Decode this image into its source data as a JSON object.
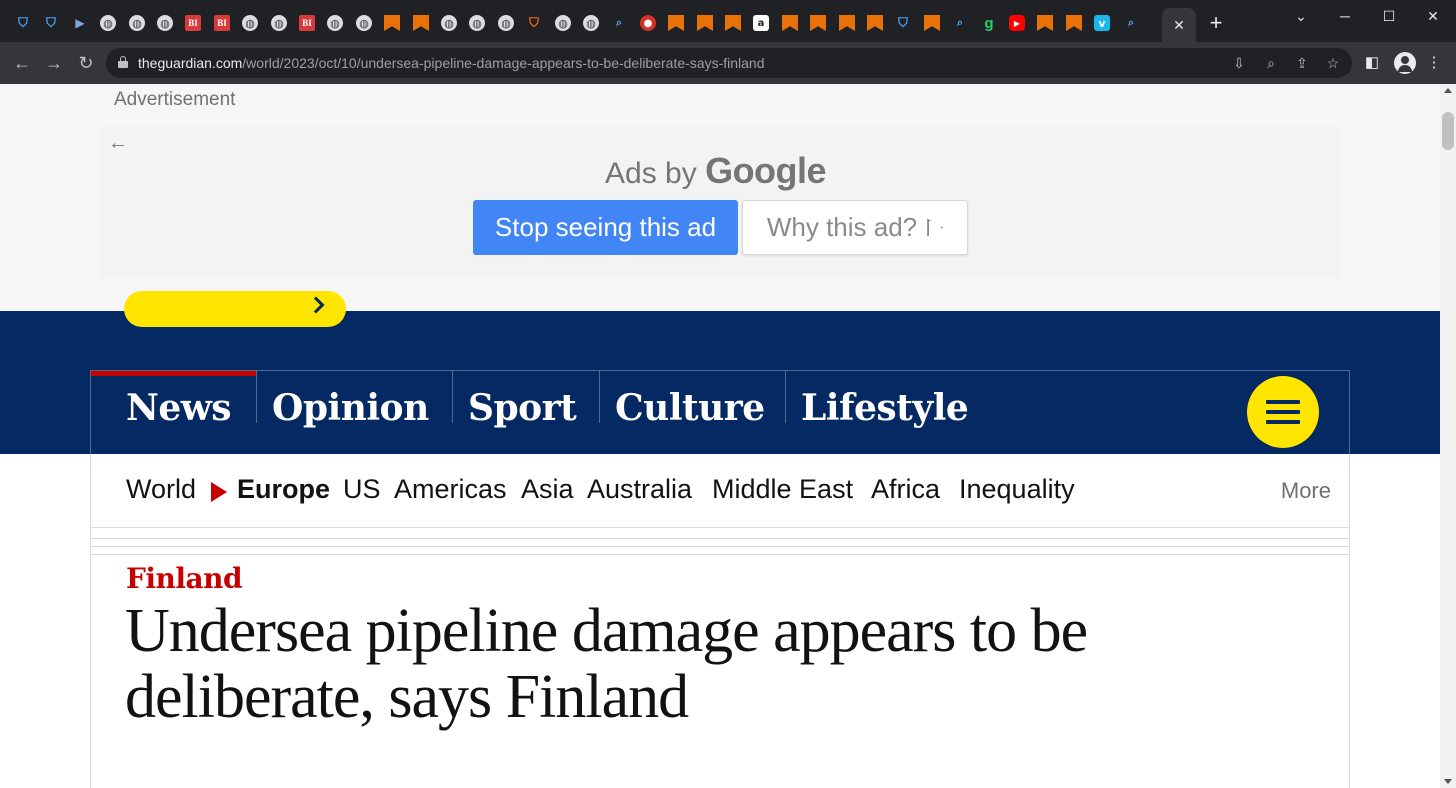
{
  "browser": {
    "tabs": [
      {
        "icon": "shield-icon",
        "glyph": "⛉",
        "kind": "shield"
      },
      {
        "icon": "shield-icon",
        "glyph": "⛉",
        "kind": "shield"
      },
      {
        "icon": "arrow-icon",
        "glyph": "▶",
        "kind": "arrow"
      },
      {
        "icon": "globe-icon",
        "glyph": "◍",
        "kind": "globe"
      },
      {
        "icon": "globe-icon",
        "glyph": "◍",
        "kind": "globe"
      },
      {
        "icon": "globe-icon",
        "glyph": "◍",
        "kind": "globe"
      },
      {
        "icon": "business-insider-icon",
        "glyph": "BI",
        "kind": "bi"
      },
      {
        "icon": "business-insider-icon",
        "glyph": "BI",
        "kind": "bi"
      },
      {
        "icon": "globe-icon",
        "glyph": "◍",
        "kind": "globe"
      },
      {
        "icon": "globe-icon",
        "glyph": "◍",
        "kind": "globe"
      },
      {
        "icon": "business-insider-icon",
        "glyph": "BI",
        "kind": "bi"
      },
      {
        "icon": "globe-icon",
        "glyph": "◍",
        "kind": "globe"
      },
      {
        "icon": "globe-icon",
        "glyph": "◍",
        "kind": "globe"
      },
      {
        "icon": "bookmark-icon",
        "glyph": "",
        "kind": "bookmark"
      },
      {
        "icon": "bookmark-icon",
        "glyph": "",
        "kind": "bookmark"
      },
      {
        "icon": "globe-icon",
        "glyph": "◍",
        "kind": "globe"
      },
      {
        "icon": "globe-icon",
        "glyph": "◍",
        "kind": "globe"
      },
      {
        "icon": "globe-icon",
        "glyph": "◍",
        "kind": "globe"
      },
      {
        "icon": "brave-icon",
        "glyph": "⛉",
        "kind": "brave"
      },
      {
        "icon": "globe-icon",
        "glyph": "◍",
        "kind": "globe"
      },
      {
        "icon": "globe-icon",
        "glyph": "◍",
        "kind": "globe"
      },
      {
        "icon": "search-icon",
        "glyph": "⌕",
        "kind": "search"
      },
      {
        "icon": "pin-icon",
        "glyph": "●",
        "kind": "pin"
      },
      {
        "icon": "bookmark-icon",
        "glyph": "",
        "kind": "bookmark"
      },
      {
        "icon": "bookmark-icon",
        "glyph": "",
        "kind": "bookmark"
      },
      {
        "icon": "bookmark-icon",
        "glyph": "",
        "kind": "bookmark"
      },
      {
        "icon": "document-icon",
        "glyph": "a",
        "kind": "white"
      },
      {
        "icon": "bookmark-icon",
        "glyph": "",
        "kind": "bookmark"
      },
      {
        "icon": "bookmark-icon",
        "glyph": "",
        "kind": "bookmark"
      },
      {
        "icon": "bookmark-icon",
        "glyph": "",
        "kind": "bookmark"
      },
      {
        "icon": "bookmark-icon",
        "glyph": "",
        "kind": "bookmark"
      },
      {
        "icon": "shield-icon",
        "glyph": "⛉",
        "kind": "shield"
      },
      {
        "icon": "bookmark-icon",
        "glyph": "",
        "kind": "bookmark"
      },
      {
        "icon": "search-icon",
        "glyph": "⌕",
        "kind": "search"
      },
      {
        "icon": "grammarly-icon",
        "glyph": "g",
        "kind": "g"
      },
      {
        "icon": "youtube-icon",
        "glyph": "▶",
        "kind": "youtube"
      },
      {
        "icon": "bookmark-icon",
        "glyph": "",
        "kind": "bookmark"
      },
      {
        "icon": "bookmark-icon",
        "glyph": "",
        "kind": "bookmark"
      },
      {
        "icon": "vimeo-icon",
        "glyph": "v",
        "kind": "v"
      },
      {
        "icon": "search-icon",
        "glyph": "⌕",
        "kind": "search"
      }
    ],
    "active_tab_close": "✕",
    "new_tab": "+",
    "window": {
      "minimize": "─",
      "maximize": "☐",
      "close": "✕",
      "dropdown": "⌄"
    },
    "nav": {
      "back": "←",
      "forward": "→",
      "reload": "↻"
    },
    "address": {
      "host": "theguardian.com",
      "path": "/world/2023/oct/10/undersea-pipeline-damage-appears-to-be-deliberate-says-finland"
    },
    "omni_icons": {
      "install": "⇩",
      "zoom": "⌕",
      "share": "⇪",
      "bookmark": "☆"
    },
    "toolbar_icons": {
      "sidepanel": "◧",
      "menu": "⋮"
    }
  },
  "ad": {
    "label": "Advertisement",
    "back": "←",
    "ads_by": "Ads by",
    "google": "Google",
    "stop_button": "Stop seeing this ad",
    "why_button": "Why this ad?"
  },
  "guardian": {
    "colors": {
      "brand": "#052962",
      "accent": "#ffe500",
      "news": "#c70000"
    },
    "pillars": [
      "News",
      "Opinion",
      "Sport",
      "Culture",
      "Lifestyle"
    ],
    "active_pillar": "News",
    "subnav": {
      "parent": "World",
      "current": "Europe",
      "links": [
        "US",
        "Americas",
        "Asia",
        "Australia",
        "Middle East",
        "Africa",
        "Inequality"
      ],
      "more": "More"
    },
    "article": {
      "kicker": "Finland",
      "headline": "Undersea pipeline damage appears to be deliberate, says Finland"
    }
  }
}
